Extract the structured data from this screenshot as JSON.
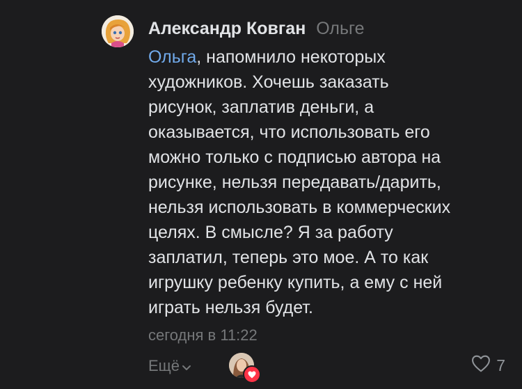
{
  "comment": {
    "author": "Александр Ковган",
    "reply_to": "Ольге",
    "mention": "Ольга",
    "lines": [
      ", напомнило некоторых",
      "художников. Хочешь заказать",
      "рисунок, заплатив деньги, а",
      "оказывается, что использовать его",
      "можно только с подписью автора на",
      "рисунке, нельзя передавать/дарить,",
      "нельзя использовать в коммерческих",
      "целях. В смысле? Я за работу",
      "заплатил, теперь это мое. А то как",
      "игрушку ребенку купить, а ему с ней",
      "играть нельзя будет."
    ],
    "time": "сегодня в 11:22",
    "more_label": "Ещё",
    "likes_count": "7"
  },
  "colors": {
    "background": "#1c1c1e",
    "text": "#e1e3e6",
    "secondary": "#76787a",
    "mention": "#71aaeb",
    "heart_badge": "#ff3347"
  },
  "icons": {
    "more": "chevron-down-icon",
    "like": "heart-outline-icon",
    "liker_badge": "heart-filled-icon"
  }
}
